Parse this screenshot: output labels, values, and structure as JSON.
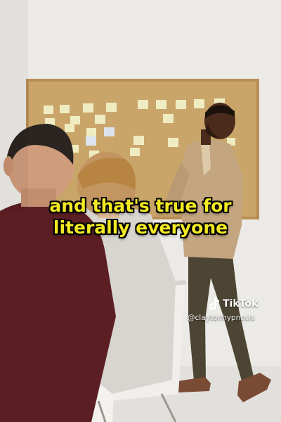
{
  "caption": {
    "line1": "and that's true for",
    "line2": "literally everyone"
  },
  "watermark": {
    "brand": "TikTok",
    "handle": "@claytonhypnosis",
    "icon": "tiktok-note-icon"
  },
  "colors": {
    "caption_text": "#f2ea23",
    "caption_outline": "#000000",
    "wall": "#ebeae7",
    "corkboard": "#c9a56a",
    "board_frame": "#b78d55",
    "sticky_note": "#efecc2",
    "blazer": "#c3a57f",
    "trousers": "#4d4533",
    "maroon_sweater": "#5b1f23",
    "chair": "#f3f2ef"
  }
}
